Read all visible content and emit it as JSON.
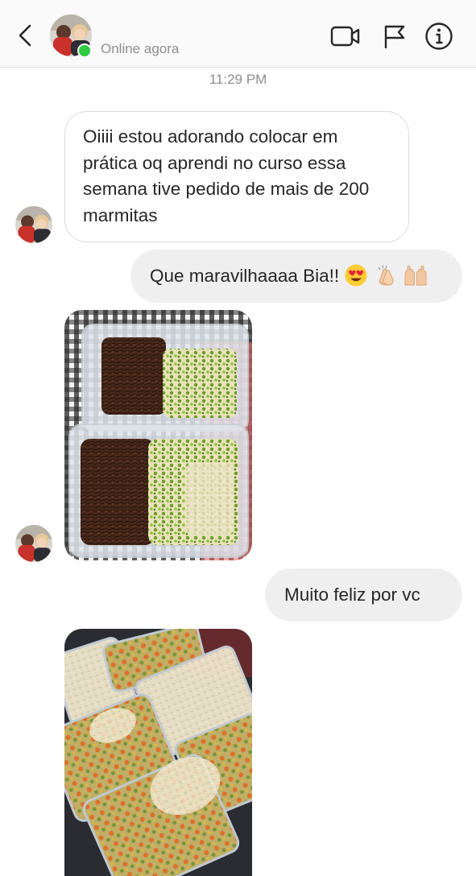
{
  "header": {
    "username": "",
    "status": "Online agora",
    "icons": {
      "back": "chevron-left-icon",
      "video": "video-camera-icon",
      "flag": "flag-icon",
      "info": "info-icon"
    }
  },
  "thread": {
    "timestamp": "11:29 PM",
    "messages": [
      {
        "from": "other",
        "type": "text",
        "text": "Oiiii estou adorando colocar em prática oq aprendi no curso essa semana tive pedido de mais de 200 marmitas"
      },
      {
        "from": "me",
        "type": "text",
        "text": "Que maravilhaaaa Bia!!",
        "emojis": [
          "heart-eyes-emoji",
          "clapping-hands-emoji",
          "raising-hands-emoji"
        ]
      },
      {
        "from": "other",
        "type": "image",
        "image": "photo-of-meal-containers-beef-and-rice"
      },
      {
        "from": "me",
        "type": "text",
        "text": "Muito feliz por vc"
      },
      {
        "from": "other",
        "type": "image",
        "image": "photo-of-meal-containers-rice-and-vegetables"
      }
    ]
  },
  "colors": {
    "online": "#2ecc40",
    "bubble_out_bg": "#efefef",
    "bubble_in_border": "#dbdbdb",
    "muted_text": "#8e8e8e"
  }
}
